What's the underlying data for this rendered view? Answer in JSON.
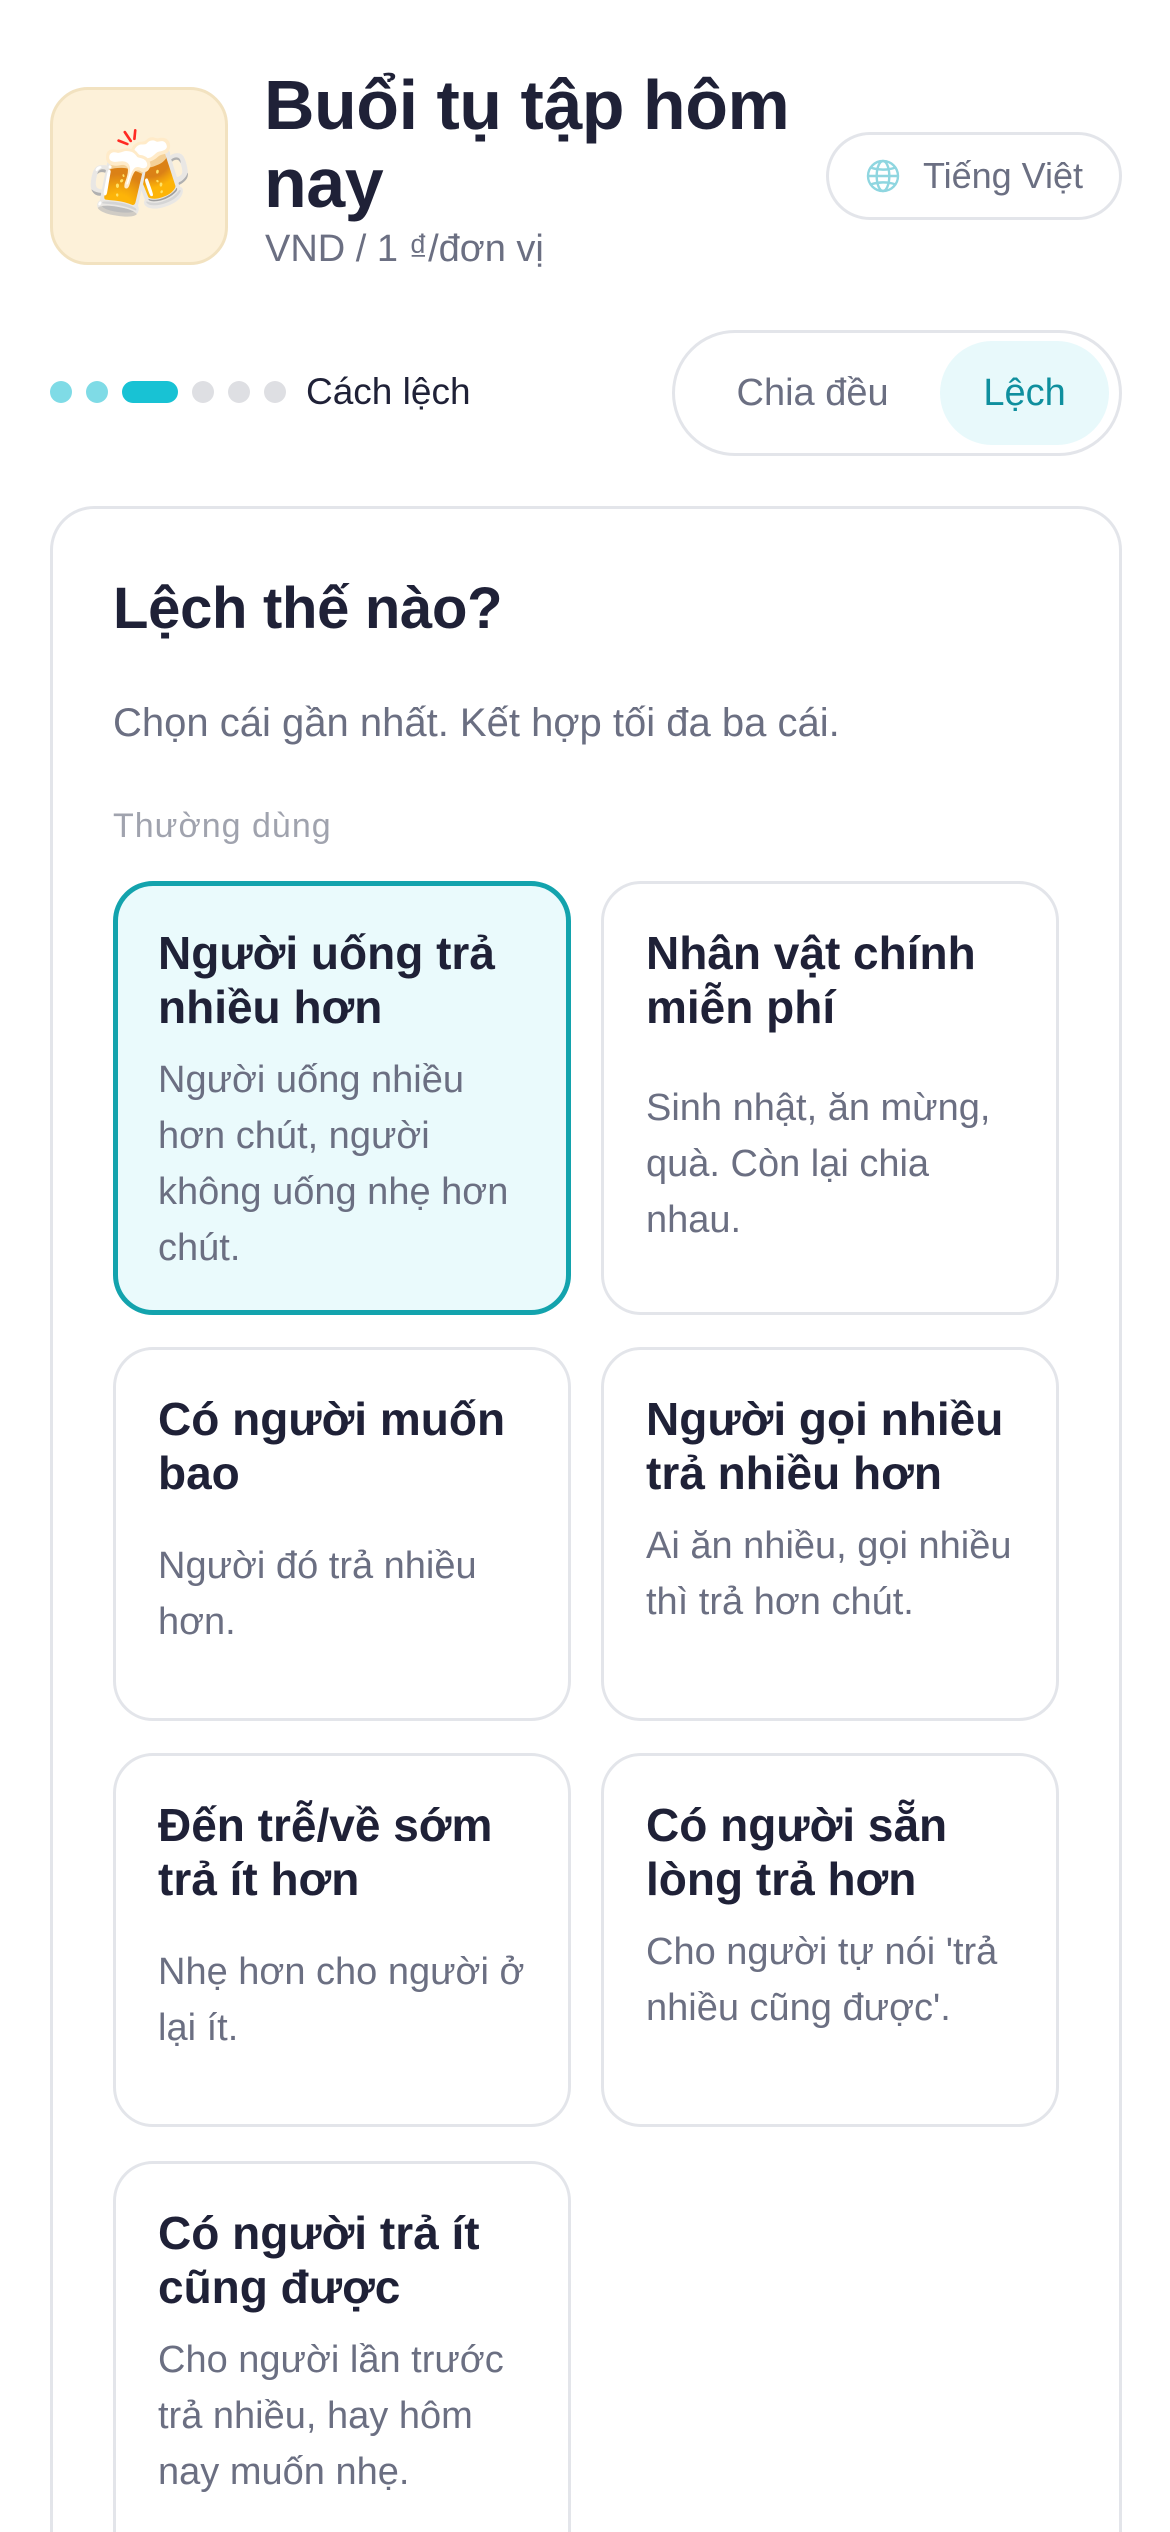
{
  "header": {
    "app_icon": "beer-mugs-icon",
    "app_icon_glyph": "🍻",
    "title": "Buổi tụ tập hôm nay",
    "subtitle": "VND / 1 ₫/đơn vị",
    "language": "Tiếng Việt"
  },
  "progress": {
    "total_steps": 6,
    "current_step": 3,
    "label": "Cách lệch"
  },
  "mode_toggle": {
    "even_label": "Chia đều",
    "skew_label": "Lệch",
    "selected": "Lệch"
  },
  "colors": {
    "accent": "#18c2d4",
    "accent_dark": "#0f8f9e",
    "selected_border": "#13a3ad",
    "selected_bg": "#eafafc"
  },
  "card": {
    "title": "Lệch thế nào?",
    "description": "Chọn cái gần nhất. Kết hợp tối đa ba cái.",
    "section_label": "Thường dùng",
    "options": [
      {
        "title": "Người uống trả nhiều hơn",
        "description": "Người uống nhiều hơn chút, người không uống nhẹ hơn chút.",
        "selected": true
      },
      {
        "title": "Nhân vật chính miễn phí",
        "description": "Sinh nhật, ăn mừng, quà. Còn lại chia nhau.",
        "selected": false
      },
      {
        "title": "Có người muốn bao",
        "description": "Người đó trả nhiều hơn.",
        "selected": false
      },
      {
        "title": "Người gọi nhiều trả nhiều hơn",
        "description": "Ai ăn nhiều, gọi nhiều thì trả hơn chút.",
        "selected": false
      },
      {
        "title": "Đến trễ/về sớm trả ít hơn",
        "description": "Nhẹ hơn cho người ở lại ít.",
        "selected": false
      },
      {
        "title": "Có người sẵn lòng trả hơn",
        "description": "Cho người tự nói 'trả nhiều cũng được'.",
        "selected": false
      },
      {
        "title": "Có người trả ít cũng được",
        "description": "Cho người lần trước trả nhiều, hay hôm nay muốn nhẹ.",
        "selected": false
      }
    ]
  }
}
